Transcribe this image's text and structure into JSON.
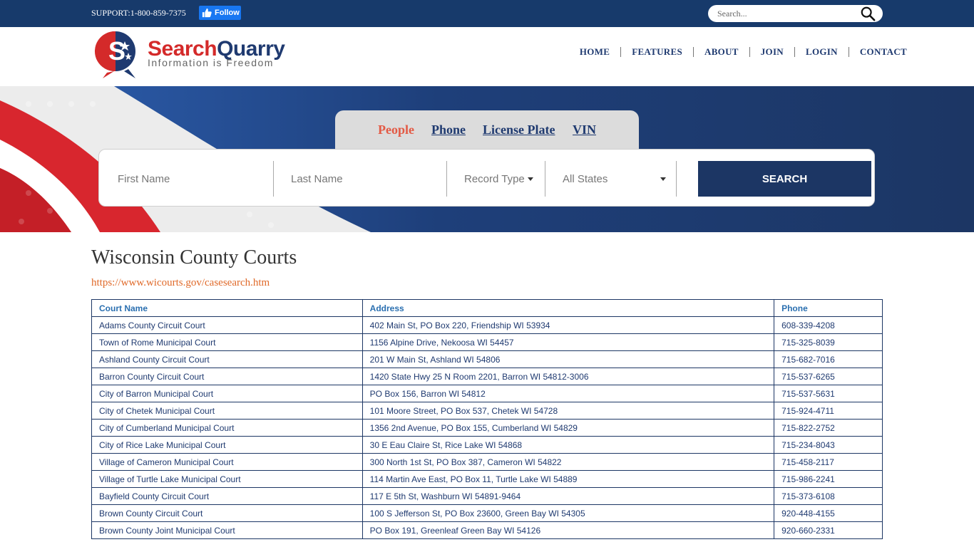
{
  "topbar": {
    "support": "SUPPORT:1-800-859-7375",
    "follow_label": "Follow",
    "search_placeholder": "Search..."
  },
  "brand": {
    "name_part1": "Search",
    "name_part2": "Quarry",
    "tagline": "Information is Freedom",
    "colors": {
      "red": "#d42a2a",
      "navy": "#1f3a70"
    }
  },
  "nav": [
    "HOME",
    "FEATURES",
    "ABOUT",
    "JOIN",
    "LOGIN",
    "CONTACT"
  ],
  "search_tabs": {
    "people": "People",
    "phone": "Phone",
    "license_plate": "License Plate",
    "vin": "VIN"
  },
  "search_form": {
    "first_name_placeholder": "First Name",
    "last_name_placeholder": "Last Name",
    "record_type": "Record Type",
    "states": "All States",
    "submit": "SEARCH"
  },
  "page": {
    "title": "Wisconsin County Courts",
    "link": "https://www.wicourts.gov/casesearch.htm"
  },
  "table": {
    "headers": [
      "Court Name",
      "Address",
      "Phone"
    ],
    "rows": [
      [
        "Adams County Circuit Court",
        "402 Main St, PO Box 220, Friendship WI 53934",
        "608-339-4208"
      ],
      [
        "Town of Rome Municipal Court",
        "1156 Alpine Drive, Nekoosa WI 54457",
        "715-325-8039"
      ],
      [
        "Ashland County Circuit Court",
        "201 W Main St, Ashland WI 54806",
        "715-682-7016"
      ],
      [
        "Barron County Circuit Court",
        "1420 State Hwy 25 N Room 2201, Barron WI 54812-3006",
        "715-537-6265"
      ],
      [
        "City of Barron Municipal Court",
        "PO Box 156, Barron WI 54812",
        "715-537-5631"
      ],
      [
        "City of Chetek Municipal Court",
        "101 Moore Street, PO Box 537, Chetek WI 54728",
        "715-924-4711"
      ],
      [
        "City of Cumberland Municipal Court",
        "1356 2nd Avenue, PO Box 155, Cumberland WI 54829",
        "715-822-2752"
      ],
      [
        "City of Rice Lake Municipal Court",
        "30 E Eau Claire St, Rice Lake WI 54868",
        "715-234-8043"
      ],
      [
        "Village of Cameron Municipal Court",
        "300 North 1st St, PO Box 387, Cameron WI 54822",
        "715-458-2117"
      ],
      [
        "Village of Turtle Lake Municipal Court",
        "114 Martin Ave East, PO Box 11, Turtle Lake WI 54889",
        "715-986-2241"
      ],
      [
        "Bayfield County Circuit Court",
        "117 E 5th St, Washburn WI 54891-9464",
        "715-373-6108"
      ],
      [
        "Brown County Circuit Court",
        "100 S Jefferson St, PO Box 23600, Green Bay WI 54305",
        "920-448-4155"
      ],
      [
        "Brown County Joint Municipal Court",
        "PO Box 191, Greenleaf Green Bay WI 54126",
        "920-660-2331"
      ]
    ]
  }
}
